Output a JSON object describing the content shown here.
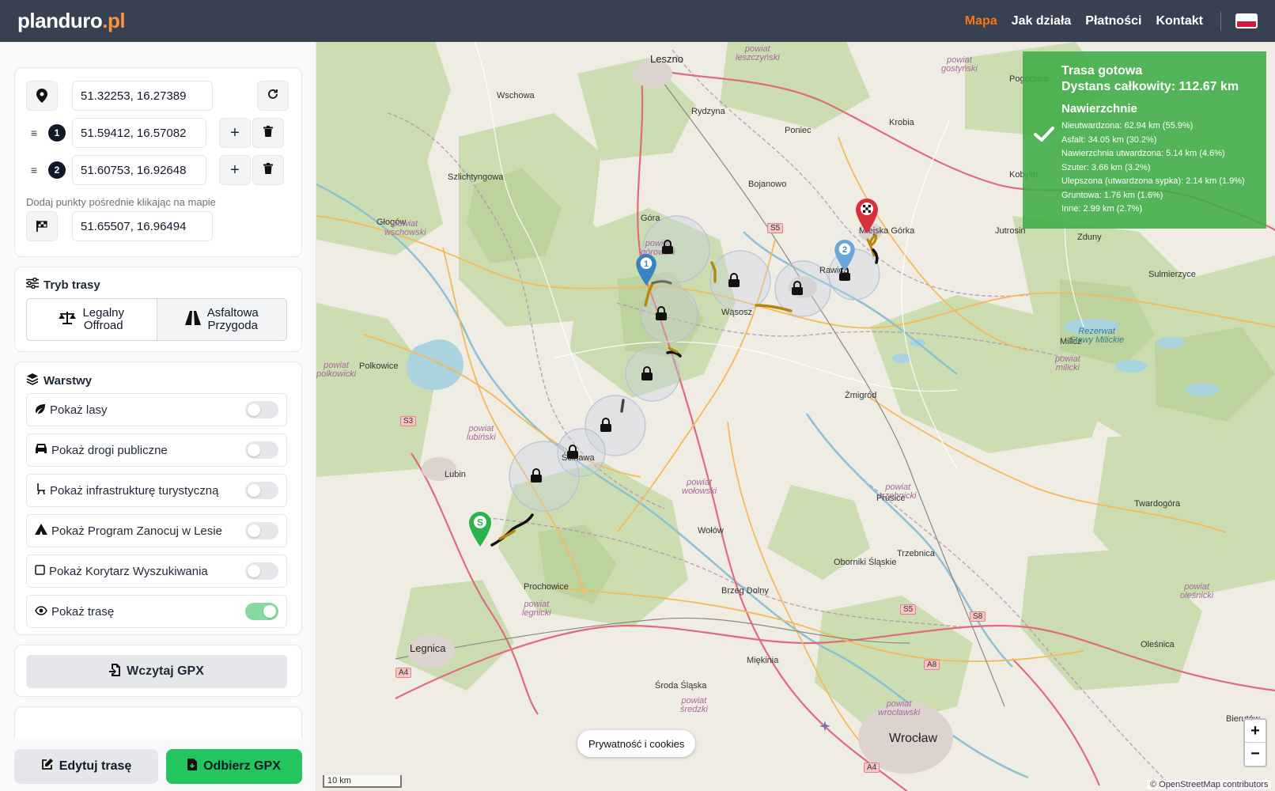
{
  "header": {
    "logo_main": "planduro",
    "logo_suffix": ".pl",
    "nav": [
      "Mapa",
      "Jak działa",
      "Płatności",
      "Kontakt"
    ],
    "flag_colors": [
      "#ffffff",
      "#dc143c"
    ]
  },
  "points": {
    "start": "51.32253, 16.27389",
    "waypoint_1_num": "1",
    "waypoint_1": "51.59412, 16.57082",
    "waypoint_2_num": "2",
    "waypoint_2": "51.60753, 16.92648",
    "hint": "Dodaj punkty pośrednie klikając na mapie",
    "finish": "51.65507, 16.96494"
  },
  "mode": {
    "title": "Tryb trasy",
    "option1_line1": "Legalny",
    "option1_line2": "Offroad",
    "option2_line1": "Asfaltowa",
    "option2_line2": "Przygoda",
    "selected": "Legalny Offroad"
  },
  "layers": {
    "title": "Warstwy",
    "items": [
      {
        "label": "Pokaż lasy",
        "on": false
      },
      {
        "label": "Pokaż drogi publiczne",
        "on": false
      },
      {
        "label": "Pokaż infrastrukturę turystyczną",
        "on": false
      },
      {
        "label": "Pokaż Program Zanocuj w Lesie",
        "on": false
      },
      {
        "label": "Pokaż Korytarz Wyszukiwania",
        "on": false
      },
      {
        "label": "Pokaż trasę",
        "on": true
      }
    ]
  },
  "gpx": {
    "load_label": "Wczytaj GPX"
  },
  "actions": {
    "edit_label": "Edytuj trasę",
    "download_label": "Odbierz GPX"
  },
  "route_info": {
    "title": "Trasa gotowa",
    "distance": "Dystans całkowity: 112.67 km",
    "surfaces_title": "Nawierzchnie",
    "surfaces": [
      "Nieutwardzona: 62.94 km (55.9%)",
      "Asfalt: 34.05 km (30.2%)",
      "Nawierzchnia utwardzona: 5.14 km (4.6%)",
      "Szuter: 3.66 km (3.2%)",
      "Ulepszona (utwardzona sypka): 2.14 km (1.9%)",
      "Gruntowa: 1.76 km (1.6%)",
      "Inne: 2.99 km (2.7%)"
    ]
  },
  "map": {
    "places": {
      "leszno": "Leszno",
      "wschowa": "Wschowa",
      "rydzyna": "Rydzyna",
      "poniec": "Poniec",
      "krobia": "Krobia",
      "szlichtyngowa": "Szlichtyngowa",
      "bojanowo": "Bojanowo",
      "glogow": "Głogów",
      "gora": "Góra",
      "miejska_gorka": "Miejska Górka",
      "jutrosin": "Jutrosin",
      "zduny": "Zduny",
      "rawicz": "Rawicz",
      "sulmierzyce": "Sulmierzyce",
      "wasosz": "Wąsosz",
      "polkowice": "Polkowice",
      "milicz": "Milicz",
      "zmigrod": "Żmigród",
      "lubin": "Lubin",
      "scinawa": "Ścinawa",
      "prusice": "Prusice",
      "twardogora": "Twardogóra",
      "wolow": "Wołów",
      "trzebnica": "Trzebnica",
      "oborniki": "Oborniki Śląskie",
      "prochowice": "Prochowice",
      "brzeg_dolny": "Brzeg Dolny",
      "legnica": "Legnica",
      "miekinia": "Miękinia",
      "olesnica": "Oleśnica",
      "sroda": "Środa Śląska",
      "wroclaw": "Wrocław",
      "bierutow": "Bierutów",
      "pogorzela": "Pogorzela",
      "kobylin": "Kobylin"
    },
    "districts": {
      "wschowski": "powiat\nwschowski",
      "leszczynski": "powiat\nleszczyński",
      "gostynski": "powiat\ngostyński",
      "gorowski": "powiat\ngórowski",
      "polkowicki": "powiat\npolkowicki",
      "lubinski": "powiat\nlubiński",
      "wolowski": "powiat\nwołowski",
      "trzebnicki": "powiat\ntrzebnicki",
      "milicki": "powiat\nmilicki",
      "legnicki": "powiat\nlegnicki",
      "sredzki": "powiat\nśredzki",
      "olesnicki": "powiat\noleśnicki",
      "wroclawski": "powiat\nwrocławski"
    },
    "reserve": "Rezerwat\nStawy Milickie",
    "road_badges": [
      "S5",
      "S3",
      "S5",
      "S8",
      "A8",
      "A4",
      "A4"
    ],
    "marker_start": "S",
    "marker_1": "1",
    "marker_2": "2",
    "scale": "10 km",
    "attribution": "© OpenStreetMap contributors",
    "privacy": "Prywatność i cookies",
    "zoom_in": "+",
    "zoom_out": "−"
  },
  "colors": {
    "header_bg": "#374151",
    "accent": "#f97316",
    "success": "#22c55e",
    "info_panel": "#3eac46"
  }
}
